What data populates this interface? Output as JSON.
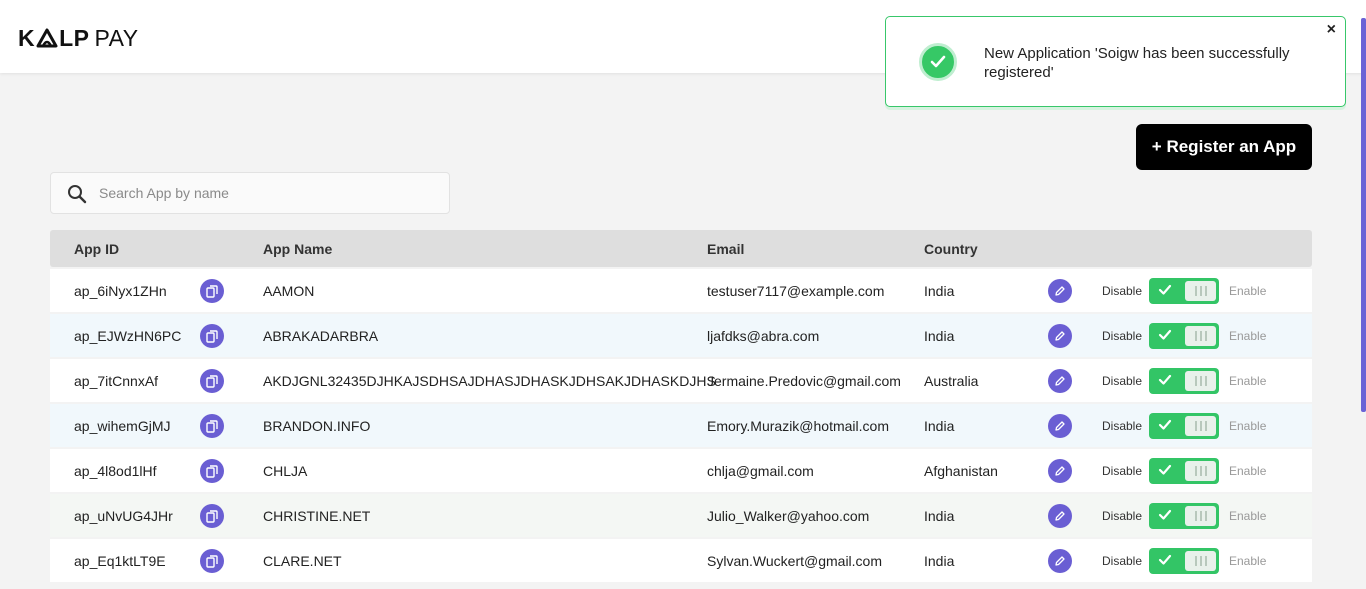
{
  "brand": {
    "logo_bold": "K",
    "logo_bold2": "LP",
    "logo_light": "PAY"
  },
  "toast": {
    "message": "New Application 'Soigw has been successfully registered'",
    "close_label": "×",
    "icon": "check-circle-icon",
    "color": "#36c866"
  },
  "actions": {
    "register_label": "+ Register an App"
  },
  "search": {
    "placeholder": "Search App by name",
    "value": ""
  },
  "table": {
    "headers": {
      "app_id": "App ID",
      "app_name": "App Name",
      "email": "Email",
      "country": "Country"
    },
    "toggle_labels": {
      "disable": "Disable",
      "enable": "Enable"
    },
    "rows": [
      {
        "app_id": "ap_6iNyx1ZHn",
        "app_name": "AAMON",
        "email": "testuser7117@example.com",
        "country": "India",
        "enabled": true
      },
      {
        "app_id": "ap_EJWzHN6PC",
        "app_name": "ABRAKADARBRA",
        "email": "ljafdks@abra.com",
        "country": "India",
        "enabled": true
      },
      {
        "app_id": "ap_7itCnnxAf",
        "app_name": "AKDJGNL32435DJHKAJSDHSAJDHASJDHASKJDHSAKJDHASKDJHS",
        "email": "Jermaine.Predovic@gmail.com",
        "country": "Australia",
        "enabled": true
      },
      {
        "app_id": "ap_wihemGjMJ",
        "app_name": "BRANDON.INFO",
        "email": "Emory.Murazik@hotmail.com",
        "country": "India",
        "enabled": true
      },
      {
        "app_id": "ap_4l8od1lHf",
        "app_name": "CHLJA",
        "email": "chlja@gmail.com",
        "country": "Afghanistan",
        "enabled": true
      },
      {
        "app_id": "ap_uNvUG4JHr",
        "app_name": "CHRISTINE.NET",
        "email": "Julio_Walker@yahoo.com",
        "country": "India",
        "enabled": true
      },
      {
        "app_id": "ap_Eq1ktLT9E",
        "app_name": "CLARE.NET",
        "email": "Sylvan.Wuckert@gmail.com",
        "country": "India",
        "enabled": true
      }
    ]
  },
  "colors": {
    "accent": "#6a5ed3",
    "toggle_on": "#33c566",
    "primary_button": "#000000"
  }
}
